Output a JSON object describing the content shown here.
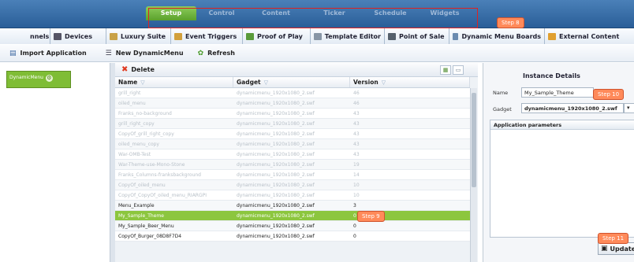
{
  "top_nav": [
    "Setup",
    "Control",
    "Content",
    "Ticker",
    "Schedule",
    "Widgets"
  ],
  "top_nav_active": "Setup",
  "tabs": [
    {
      "label": "nnels",
      "icon": "channels-icon",
      "color": "#6a8fbf"
    },
    {
      "label": "Devices",
      "icon": "devices-icon",
      "color": "#556"
    },
    {
      "label": "Luxury Suite",
      "icon": "suite-icon",
      "color": "#c9a248"
    },
    {
      "label": "Event Triggers",
      "icon": "trigger-icon",
      "color": "#d2a03c"
    },
    {
      "label": "Proof of Play",
      "icon": "proof-icon",
      "color": "#5a9b3a"
    },
    {
      "label": "Template Editor",
      "icon": "template-icon",
      "color": "#8896a6"
    },
    {
      "label": "Point of Sale",
      "icon": "pos-icon",
      "color": "#55606c"
    },
    {
      "label": "Dynamic Menu Boards",
      "icon": "menu-board-icon",
      "color": "#6b8bb0"
    },
    {
      "label": "External Content",
      "icon": "external-icon",
      "color": "#e0a030"
    }
  ],
  "toolbar": {
    "import_label": "Import Application",
    "new_label": "New DynamicMenu",
    "refresh_label": "Refresh"
  },
  "sidebar": {
    "item_label": "DynamicMenu"
  },
  "grid": {
    "delete_label": "Delete",
    "columns": [
      "Name",
      "Gadget",
      "Version"
    ],
    "rows": [
      {
        "name": "grill_right",
        "gadget": "dynamicmenu_1920x1080_2.swf",
        "version": "46",
        "state": "faded"
      },
      {
        "name": "oiled_menu",
        "gadget": "dynamicmenu_1920x1080_2.swf",
        "version": "46",
        "state": "faded"
      },
      {
        "name": "Franks_no-background",
        "gadget": "dynamicmenu_1920x1080_2.swf",
        "version": "43",
        "state": "faded"
      },
      {
        "name": "grill_right_copy",
        "gadget": "dynamicmenu_1920x1080_2.swf",
        "version": "43",
        "state": "faded"
      },
      {
        "name": "CopyOf_grill_right_copy",
        "gadget": "dynamicmenu_1920x1080_2.swf",
        "version": "43",
        "state": "faded"
      },
      {
        "name": "oiled_menu_copy",
        "gadget": "dynamicmenu_1920x1080_2.swf",
        "version": "43",
        "state": "faded"
      },
      {
        "name": "War-OMB-Test",
        "gadget": "dynamicmenu_1920x1080_2.swf",
        "version": "43",
        "state": "faded"
      },
      {
        "name": "War-Theme-use-Mono-Stone",
        "gadget": "dynamicmenu_1920x1080_2.swf",
        "version": "19",
        "state": "faded"
      },
      {
        "name": "Franks_Columns-franksbackground",
        "gadget": "dynamicmenu_1920x1080_2.swf",
        "version": "14",
        "state": "faded"
      },
      {
        "name": "CopyOf_oiled_menu",
        "gadget": "dynamicmenu_1920x1080_2.swf",
        "version": "10",
        "state": "faded"
      },
      {
        "name": "CopyOf_CopyOf_oiled_menu_RIARGPI",
        "gadget": "dynamicmenu_1920x1080_2.swf",
        "version": "10",
        "state": "faded"
      },
      {
        "name": "Menu_Example",
        "gadget": "dynamicmenu_1920x1080_2.swf",
        "version": "3",
        "state": "normal"
      },
      {
        "name": "My_Sample_Theme",
        "gadget": "dynamicmenu_1920x1080_2.swf",
        "version": "0",
        "state": "selected"
      },
      {
        "name": "My_Sample_Beer_Menu",
        "gadget": "dynamicmenu_1920x1080_2.swf",
        "version": "0",
        "state": "normal"
      },
      {
        "name": "CopyOf_Burger_08D8F7D4",
        "gadget": "dynamicmenu_1920x1080_2.swf",
        "version": "0",
        "state": "normal"
      }
    ]
  },
  "details": {
    "title": "Instance Details",
    "name_label": "Name",
    "name_value": "My_Sample_Theme",
    "gadget_label": "Gadget",
    "gadget_value": "dynamicmenu_1920x1080_2.swf",
    "params_header": "Application parameters",
    "update_label": "Update"
  },
  "callouts": {
    "step8": "Step 8",
    "step9": "Step 9",
    "step10": "Step 10",
    "step11": "Step 11"
  },
  "colors": {
    "accent_green": "#8cc63e",
    "callout": "#ff8a5a",
    "highlight": "#d22222",
    "nav_blue": "#2a5e98"
  }
}
